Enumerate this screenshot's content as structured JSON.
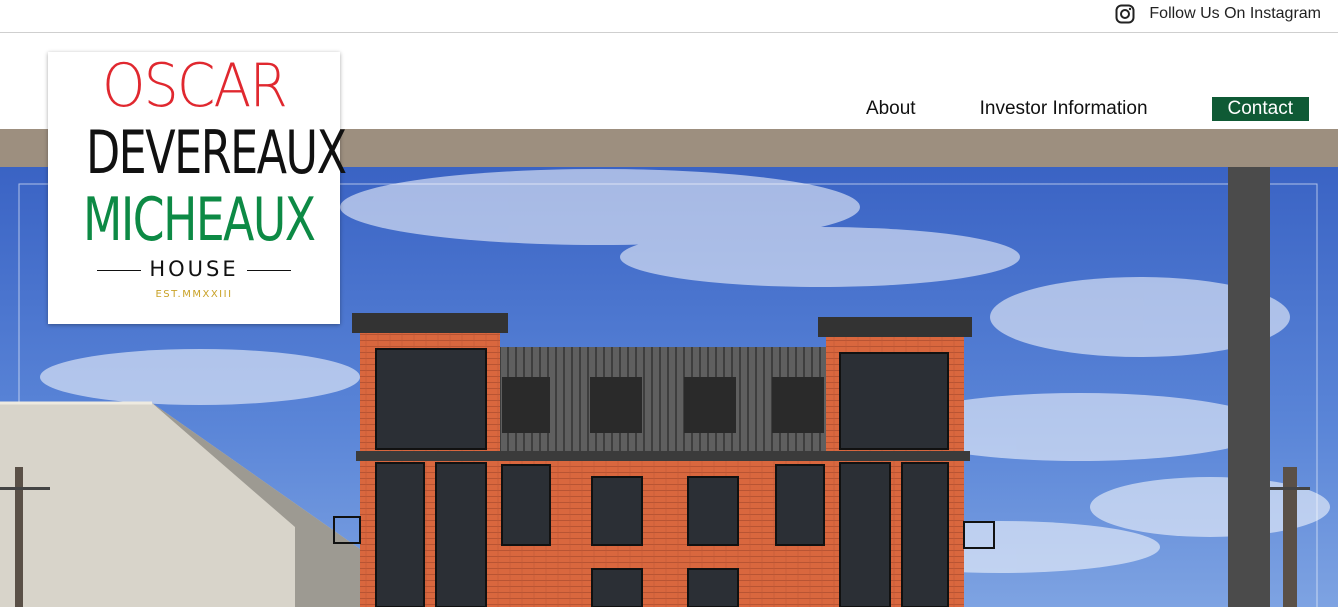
{
  "topbar": {
    "instagram_icon": "instagram-icon",
    "instagram_label": "Follow Us On Instagram"
  },
  "nav": {
    "about": "About",
    "investor": "Investor Information",
    "contact": "Contact"
  },
  "logo": {
    "line1": "OSCAR",
    "line2": "DEVEREAUX",
    "line3": "MICHEAUX",
    "line4": "HOUSE",
    "line5": "EST.MMXXIII"
  },
  "colors": {
    "accent_green": "#0f5a35",
    "band_taupe": "#9d8f7f",
    "logo_red": "#e0282f",
    "logo_green": "#0d8a45",
    "logo_gold": "#c9a227"
  }
}
